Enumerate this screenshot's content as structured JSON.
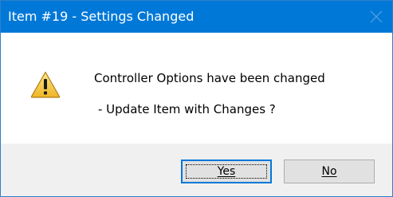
{
  "window": {
    "title": "Item #19 - Settings Changed",
    "close_icon": "close-icon",
    "colors": {
      "titlebar": "#0078d7",
      "title_text": "#ffffff",
      "footer": "#f0f0f0",
      "button_border_default": "#0078d7"
    }
  },
  "message": {
    "icon": "warning-icon",
    "line1": "Controller Options have been changed",
    "line2": "- Update Item with Changes ?"
  },
  "buttons": {
    "yes_label": "Yes",
    "no_label": "No"
  }
}
